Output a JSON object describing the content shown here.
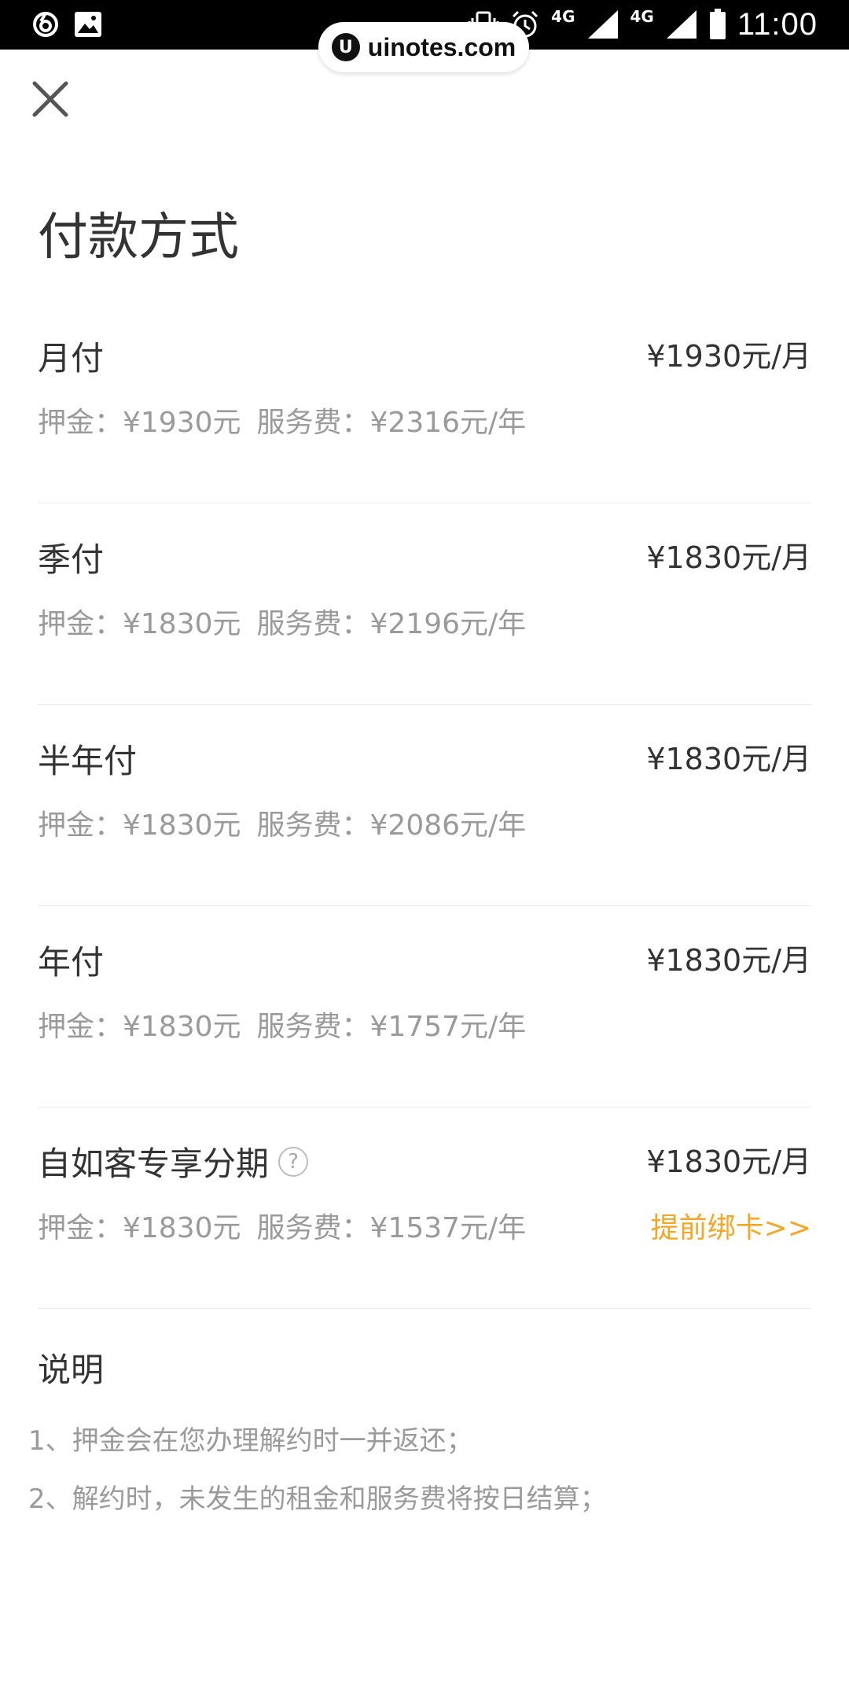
{
  "status_bar": {
    "time": "11:00",
    "network_1": "4G",
    "network_2": "4G",
    "icons": [
      "netease-icon",
      "image-icon",
      "vibrate-icon",
      "alarm-icon",
      "signal-icon",
      "battery-icon"
    ]
  },
  "watermark": {
    "logo": "U",
    "text": "uinotes.com"
  },
  "header": {
    "close_icon": "close-icon",
    "title": "付款方式"
  },
  "plans": [
    {
      "name": "月付",
      "price": "¥1930元/月",
      "deposit": "押金：¥1930元",
      "service_fee": "服务费：¥2316元/年"
    },
    {
      "name": "季付",
      "price": "¥1830元/月",
      "deposit": "押金：¥1830元",
      "service_fee": "服务费：¥2196元/年"
    },
    {
      "name": "半年付",
      "price": "¥1830元/月",
      "deposit": "押金：¥1830元",
      "service_fee": "服务费：¥2086元/年"
    },
    {
      "name": "年付",
      "price": "¥1830元/月",
      "deposit": "押金：¥1830元",
      "service_fee": "服务费：¥1757元/年"
    },
    {
      "name": "自如客专享分期",
      "help": "?",
      "price": "¥1830元/月",
      "deposit": "押金：¥1830元",
      "service_fee": "服务费：¥1537元/年",
      "action": "提前绑卡>>"
    }
  ],
  "notes": {
    "title": "说明",
    "items": [
      "1、押金会在您办理解约时一并返还；",
      "2、解约时，未发生的租金和服务费将按日结算；"
    ]
  },
  "colors": {
    "accent": "#f5a623",
    "text_primary": "#333333",
    "text_secondary": "#9a9a9a"
  }
}
